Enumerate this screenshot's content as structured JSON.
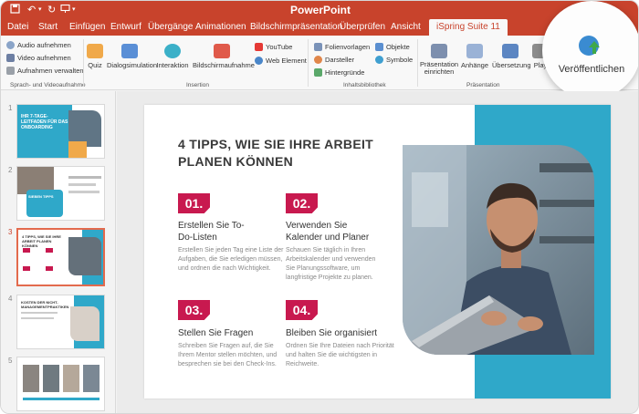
{
  "window": {
    "title": "PowerPoint"
  },
  "tabs": [
    {
      "label": "Datei"
    },
    {
      "label": "Start"
    },
    {
      "label": "Einfügen"
    },
    {
      "label": "Entwurf"
    },
    {
      "label": "Übergänge"
    },
    {
      "label": "Animationen"
    },
    {
      "label": "Bildschirmpräsentation"
    },
    {
      "label": "Überprüfen"
    },
    {
      "label": "Ansicht"
    },
    {
      "label": "iSpring Suite 11"
    }
  ],
  "ribbon": {
    "audio": "Audio aufnehmen",
    "video": "Video aufnehmen",
    "manage": "Aufnahmen verwalten",
    "group_record": "Sprach- und Videoaufnahme",
    "quiz": "Quiz",
    "dialog": "Dialogsimulation",
    "interaction": "Interaktion",
    "screen": "Bildschirmaufnahme",
    "youtube": "YouTube",
    "webelement": "Web Element",
    "group_insert": "Insertion",
    "templates": "Folienvorlagen",
    "actors": "Darsteller",
    "backgrounds": "Hintergründe",
    "objects": "Objekte",
    "symbols": "Symbole",
    "group_library": "Inhaltsbibliothek",
    "setup": "Präsentation einrichten",
    "attachments": "Anhänge",
    "translation": "Übersetzung",
    "play": "Play",
    "group_presentation": "Präsentation",
    "publish": "Veröffentlichen"
  },
  "thumbnails": [
    {
      "num": "1",
      "title": "IHR 7-TAGE-LEITFADEN FÜR DAS ONBOARDING"
    },
    {
      "num": "2",
      "title": "SIEBEN TIPPS"
    },
    {
      "num": "3",
      "title": "4 TIPPS, WIE SIE IHRE ARBEIT PLANEN KÖNNEN"
    },
    {
      "num": "4",
      "title": "KOSTEN DER NICHT-MANAGEMENTPRAKTIKEN"
    },
    {
      "num": "5",
      "title": ""
    }
  ],
  "slide": {
    "title": "4 TIPPS, WIE SIE IHRE ARBEIT PLANEN KÖNNEN",
    "tips": [
      {
        "num": "01.",
        "heading": "Erstellen Sie To-Do-Listen",
        "text": "Erstellen Sie jeden Tag eine Liste der Aufgaben, die Sie erledigen müssen, und ordnen die nach Wichtigkeit."
      },
      {
        "num": "02.",
        "heading": "Verwenden Sie Kalender und Planer",
        "text": "Schauen Sie täglich in Ihren Arbeitskalender und verwenden Sie Planungssoftware, um langfristige Projekte zu planen."
      },
      {
        "num": "03.",
        "heading": "Stellen Sie Fragen",
        "text": "Schreiben Sie Fragen auf, die Sie Ihrem Mentor stellen möchten, und besprechen sie bei den Check-Ins."
      },
      {
        "num": "04.",
        "heading": "Bleiben Sie organisiert",
        "text": "Ordnen Sie Ihre Dateien nach Priorität und halten Sie die wichtigsten in Reichweite."
      }
    ]
  },
  "colors": {
    "brand": "#c8432c",
    "accent": "#c8194f",
    "teal": "#2fa8c9"
  }
}
